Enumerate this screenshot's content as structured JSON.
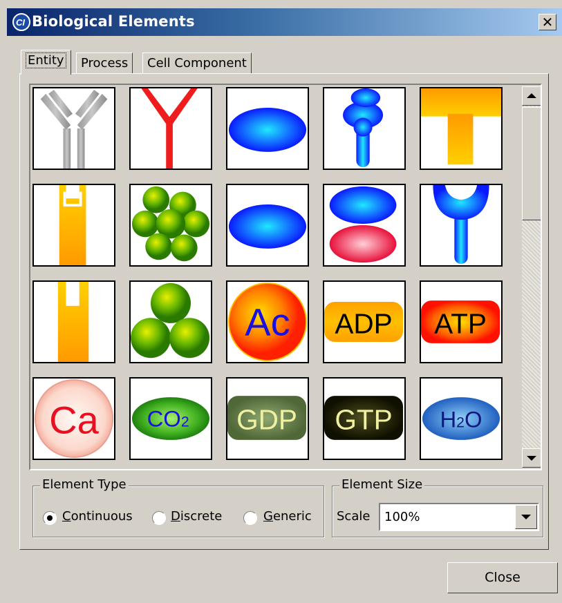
{
  "window": {
    "title": "Biological Elements",
    "close_glyph": "✕"
  },
  "tabs": [
    {
      "label": "Entity",
      "active": true
    },
    {
      "label": "Process",
      "active": false
    },
    {
      "label": "Cell Component",
      "active": false
    }
  ],
  "grid": {
    "tiles": [
      {
        "name": "gray-antibody-icon"
      },
      {
        "name": "red-receptor-y-icon"
      },
      {
        "name": "blue-ellipse-icon"
      },
      {
        "name": "blue-stacked-protein-icon"
      },
      {
        "name": "orange-t-icon"
      },
      {
        "name": "orange-channel-notch-icon"
      },
      {
        "name": "green-cluster-icon"
      },
      {
        "name": "blue-ellipse-2-icon"
      },
      {
        "name": "blue-red-dimer-icon"
      },
      {
        "name": "blue-cup-receptor-icon"
      },
      {
        "name": "orange-channel-slot-icon"
      },
      {
        "name": "green-trimer-icon"
      },
      {
        "name": "ac-icon",
        "text": "Ac"
      },
      {
        "name": "adp-icon",
        "text": "ADP"
      },
      {
        "name": "atp-icon",
        "text": "ATP"
      },
      {
        "name": "ca-icon",
        "text": "Ca"
      },
      {
        "name": "co2-icon",
        "text": "CO",
        "sub": "2"
      },
      {
        "name": "gdp-icon",
        "text": "GDP"
      },
      {
        "name": "gtp-icon",
        "text": "GTP"
      },
      {
        "name": "h2o-icon",
        "text": "H",
        "sub": "2",
        "tail": "O"
      }
    ]
  },
  "element_type": {
    "label": "Element Type",
    "options": [
      {
        "label": "Continuous",
        "mnemonic": "C",
        "rest": "ontinuous",
        "checked": true
      },
      {
        "label": "Discrete",
        "mnemonic": "D",
        "rest": "iscrete",
        "checked": false
      },
      {
        "label": "Generic",
        "mnemonic": "G",
        "rest": "eneric",
        "checked": false
      }
    ]
  },
  "element_size": {
    "label": "Element Size",
    "scale_label": "Scale",
    "scale_value": "100%"
  },
  "buttons": {
    "close": "Close"
  }
}
